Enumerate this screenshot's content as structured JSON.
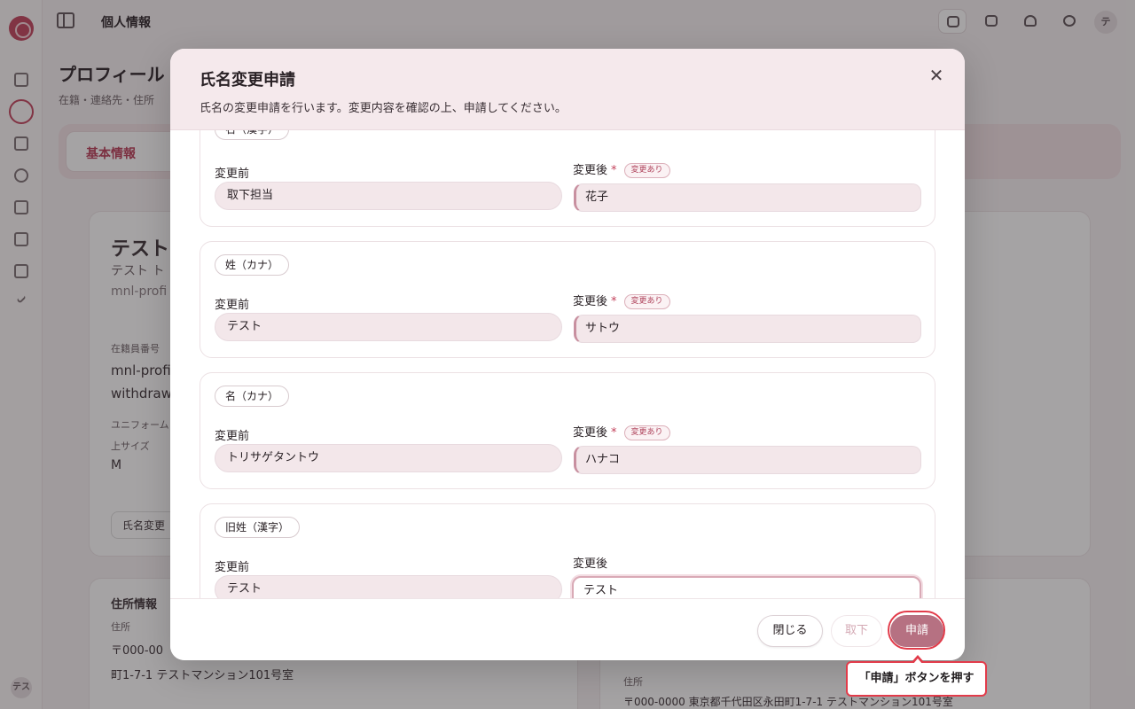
{
  "topbar": {
    "page_title": "個人情報",
    "user_initial": "テ"
  },
  "rail": {
    "user_initials": "テス"
  },
  "background": {
    "heading": "プロフィール",
    "subheading": "在籍・連絡先・住所",
    "tab_label": "基本情報",
    "card_name": "テスト",
    "card_kana": "テスト ト",
    "card_id": "mnl-profi",
    "section_label": "在籍員番号",
    "line1": "mnl-profi",
    "line2": "withdraw",
    "uniform_label": "ユニフォーム",
    "size_label": "上サイズ",
    "size_value": "M",
    "name_change_button": "氏名変更",
    "address_title": "住所情報",
    "address_label": "住所",
    "postal": "〒000-00",
    "address_line": "町1-7-1 テストマンション101号室",
    "right_address_label": "住所",
    "right_address_line": "〒000-0000 東京都千代田区永田町1-7-1 テストマンション101号室"
  },
  "modal": {
    "title": "氏名変更申請",
    "description": "氏名の変更申請を行います。変更内容を確認の上、申請してください。",
    "before_label": "変更前",
    "after_label": "変更後",
    "required_mark": "*",
    "changed_badge": "変更あり",
    "fields": [
      {
        "tag": "名（漢字）",
        "before": "取下担当",
        "after": "花子",
        "changed": true
      },
      {
        "tag": "姓（カナ）",
        "before": "テスト",
        "after": "サトウ",
        "changed": true
      },
      {
        "tag": "名（カナ）",
        "before": "トリサゲタントウ",
        "after": "ハナコ",
        "changed": true
      },
      {
        "tag": "旧姓（漢字）",
        "before": "テスト",
        "after": "テスト",
        "changed": false
      }
    ],
    "buttons": {
      "close": "閉じる",
      "withdraw": "取下",
      "apply": "申請"
    }
  },
  "tutorial": {
    "callout_text": "「申請」ボタンを押す"
  }
}
